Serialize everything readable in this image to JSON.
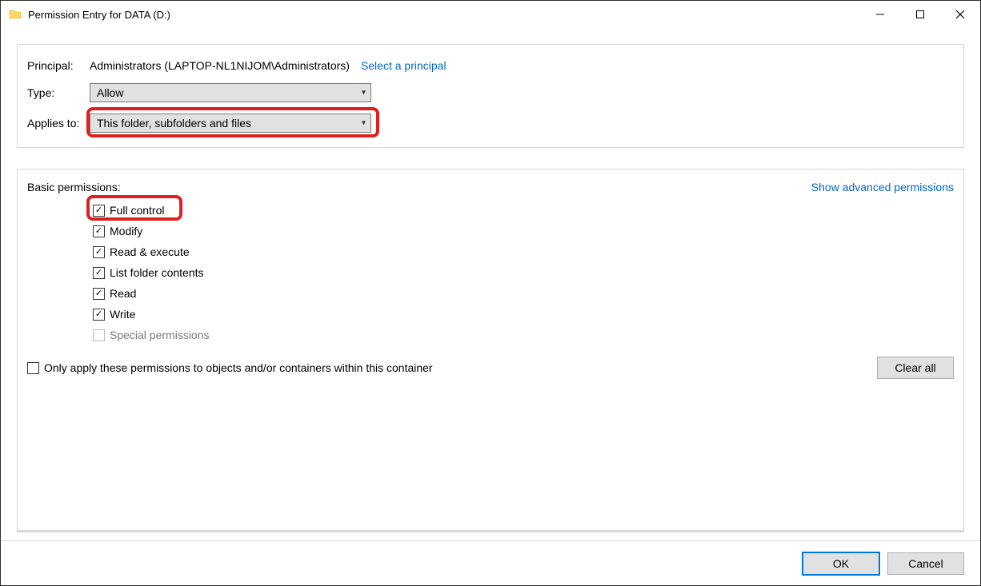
{
  "window": {
    "title": "Permission Entry for DATA (D:)"
  },
  "principal": {
    "label": "Principal:",
    "value": "Administrators (LAPTOP-NL1NIJOM\\Administrators)",
    "select_link": "Select a principal"
  },
  "type": {
    "label": "Type:",
    "value": "Allow"
  },
  "applies": {
    "label": "Applies to:",
    "value": "This folder, subfolders and files"
  },
  "basic": {
    "heading": "Basic permissions:",
    "advanced_link": "Show advanced permissions",
    "perms": {
      "full_control": "Full control",
      "modify": "Modify",
      "read_execute": "Read & execute",
      "list_folder": "List folder contents",
      "read": "Read",
      "write": "Write",
      "special": "Special permissions"
    },
    "only_apply": "Only apply these permissions to objects and/or containers within this container",
    "clear_all": "Clear all"
  },
  "footer": {
    "ok": "OK",
    "cancel": "Cancel"
  },
  "highlights": {
    "applies_to": true,
    "full_control": true
  }
}
